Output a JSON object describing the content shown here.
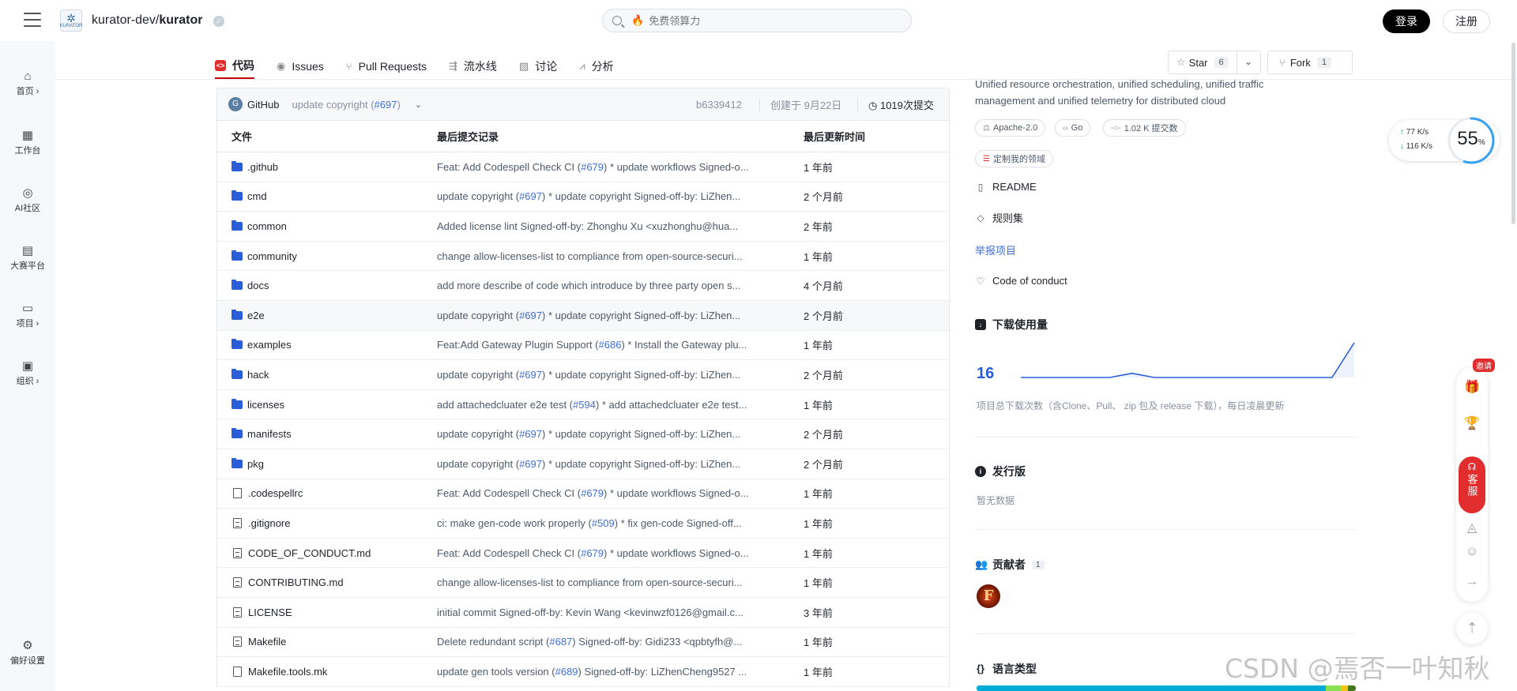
{
  "header": {
    "repo_owner": "kurator-dev/",
    "repo_name": "kurator",
    "logo_text": "KURATOR",
    "search_placeholder": "免费领算力",
    "login_label": "登录",
    "register_label": "注册"
  },
  "sidebar": {
    "items": [
      {
        "label": "首页 ›",
        "icon": "home-icon"
      },
      {
        "label": "工作台",
        "icon": "grid-icon"
      },
      {
        "label": "AI社区",
        "icon": "ai-icon"
      },
      {
        "label": "大赛平台",
        "icon": "trophy-icon"
      },
      {
        "label": "项目 ›",
        "icon": "folder-icon"
      },
      {
        "label": "组织 ›",
        "icon": "org-icon"
      }
    ],
    "settings_label": "偏好设置"
  },
  "tabs": [
    {
      "label": "代码",
      "icon": "code-icon",
      "active": true
    },
    {
      "label": "Issues",
      "icon": "issue-icon"
    },
    {
      "label": "Pull Requests",
      "icon": "pr-icon"
    },
    {
      "label": "流水线",
      "icon": "pipeline-icon"
    },
    {
      "label": "讨论",
      "icon": "discussion-icon"
    },
    {
      "label": "分析",
      "icon": "analytics-icon"
    }
  ],
  "repo_actions": {
    "star_label": "Star",
    "star_count": "6",
    "fork_label": "Fork",
    "fork_count": "1"
  },
  "latest_commit": {
    "avatar_letter": "G",
    "author": "GitHub",
    "message": "update copyright (",
    "pr": "#697",
    "message_end": ")",
    "sha": "b6339412",
    "created": "创建于 9月22日",
    "commit_count": "1019次提交"
  },
  "file_table": {
    "headers": [
      "文件",
      "最后提交记录",
      "最后更新时间"
    ],
    "rows": [
      {
        "name": ".github",
        "type": "folder",
        "msg_pre": "Feat: Add Codespell Check CI (",
        "pr": "#679",
        "msg_post": ") * update workflows Signed-o...",
        "time": "1 年前"
      },
      {
        "name": "cmd",
        "type": "folder",
        "msg_pre": "update copyright (",
        "pr": "#697",
        "msg_post": ") * update copyright Signed-off-by: LiZhen...",
        "time": "2 个月前"
      },
      {
        "name": "common",
        "type": "folder",
        "msg_pre": "Added license lint Signed-off-by: Zhonghu Xu <xuzhonghu@hua...",
        "pr": "",
        "msg_post": "",
        "time": "2 年前"
      },
      {
        "name": "community",
        "type": "folder",
        "msg_pre": "change allow-licenses-list to compliance from open-source-securi...",
        "pr": "",
        "msg_post": "",
        "time": "1 年前"
      },
      {
        "name": "docs",
        "type": "folder",
        "msg_pre": "add more describe of code which introduce by three party open s...",
        "pr": "",
        "msg_post": "",
        "time": "4 个月前"
      },
      {
        "name": "e2e",
        "type": "folder",
        "msg_pre": "update copyright (",
        "pr": "#697",
        "msg_post": ") * update copyright Signed-off-by: LiZhen...",
        "time": "2 个月前"
      },
      {
        "name": "examples",
        "type": "folder",
        "msg_pre": "Feat:Add Gateway Plugin Support (",
        "pr": "#686",
        "msg_post": ") * Install the Gateway plu...",
        "time": "1 年前"
      },
      {
        "name": "hack",
        "type": "folder",
        "msg_pre": "update copyright (",
        "pr": "#697",
        "msg_post": ") * update copyright Signed-off-by: LiZhen...",
        "time": "2 个月前"
      },
      {
        "name": "licenses",
        "type": "folder",
        "msg_pre": "add attachedcluater e2e test (",
        "pr": "#594",
        "msg_post": ") * add attachedcluater e2e test...",
        "time": "1 年前"
      },
      {
        "name": "manifests",
        "type": "folder",
        "msg_pre": "update copyright (",
        "pr": "#697",
        "msg_post": ") * update copyright Signed-off-by: LiZhen...",
        "time": "2 个月前"
      },
      {
        "name": "pkg",
        "type": "folder",
        "msg_pre": "update copyright (",
        "pr": "#697",
        "msg_post": ") * update copyright Signed-off-by: LiZhen...",
        "time": "2 个月前"
      },
      {
        "name": ".codespellrc",
        "type": "file",
        "msg_pre": "Feat: Add Codespell Check CI (",
        "pr": "#679",
        "msg_post": ") * update workflows Signed-o...",
        "time": "1 年前"
      },
      {
        "name": ".gitignore",
        "type": "doc",
        "msg_pre": "ci: make gen-code work properly (",
        "pr": "#509",
        "msg_post": ") * fix gen-code Signed-off...",
        "time": "1 年前"
      },
      {
        "name": "CODE_OF_CONDUCT.md",
        "type": "doc",
        "msg_pre": "Feat: Add Codespell Check CI (",
        "pr": "#679",
        "msg_post": ") * update workflows Signed-o...",
        "time": "1 年前"
      },
      {
        "name": "CONTRIBUTING.md",
        "type": "doc",
        "msg_pre": "change allow-licenses-list to compliance from open-source-securi...",
        "pr": "",
        "msg_post": "",
        "time": "1 年前"
      },
      {
        "name": "LICENSE",
        "type": "doc",
        "msg_pre": "initial commit Signed-off-by: Kevin Wang <kevinwzf0126@gmail.c...",
        "pr": "",
        "msg_post": "",
        "time": "3 年前"
      },
      {
        "name": "Makefile",
        "type": "doc",
        "msg_pre": "Delete redundant script (",
        "pr": "#687",
        "msg_post": ") Signed-off-by: Gidi233 <qpbtyfh@...",
        "time": "1 年前"
      },
      {
        "name": "Makefile.tools.mk",
        "type": "file",
        "msg_pre": "update gen tools version (",
        "pr": "#689",
        "msg_post": ") Signed-off-by: LiZhenCheng9527 ...",
        "time": "1 年前"
      }
    ]
  },
  "about": {
    "description": "Unified resource orchestration, unified scheduling, unified traffic management and unified telemetry for distributed cloud",
    "license": "Apache-2.0",
    "language": "Go",
    "commits_pill": "1.02 K 提交数",
    "custom_domain": "定制我的领域",
    "readme": "README",
    "ruleset": "规则集",
    "report": "举报项目",
    "code_of_conduct": "Code of conduct"
  },
  "downloads": {
    "title": "下载使用量",
    "count": "16",
    "note": "项目总下载次数（含Clone、Pull、 zip 包及 release 下载），每日凌晨更新",
    "sparkline": [
      0,
      0,
      0,
      0,
      0,
      1.2,
      0,
      0,
      0,
      0,
      0,
      0,
      0,
      0,
      0,
      10
    ],
    "line_color": "#2a5ed8"
  },
  "releases": {
    "title": "发行版",
    "empty": "暂无数据"
  },
  "contributors": {
    "title": "贡献者",
    "count": "1",
    "avatar_letter": "F"
  },
  "languages": {
    "title": "语言类型",
    "segments": [
      {
        "color": "#00acd7",
        "share": 0.92
      },
      {
        "color": "#89e051",
        "share": 0.04
      },
      {
        "color": "#f1c40f",
        "share": 0.02
      },
      {
        "color": "#427819",
        "share": 0.02
      }
    ]
  },
  "speed_widget": {
    "up_value": "77",
    "up_unit": "K/s",
    "down_value": "116",
    "down_unit": "K/s",
    "percent": "55",
    "percent_sign": "%"
  },
  "float_toolbar": {
    "invite_label": "邀请",
    "kefu_label": "客服"
  },
  "watermark": "CSDN @焉否一叶知秋"
}
